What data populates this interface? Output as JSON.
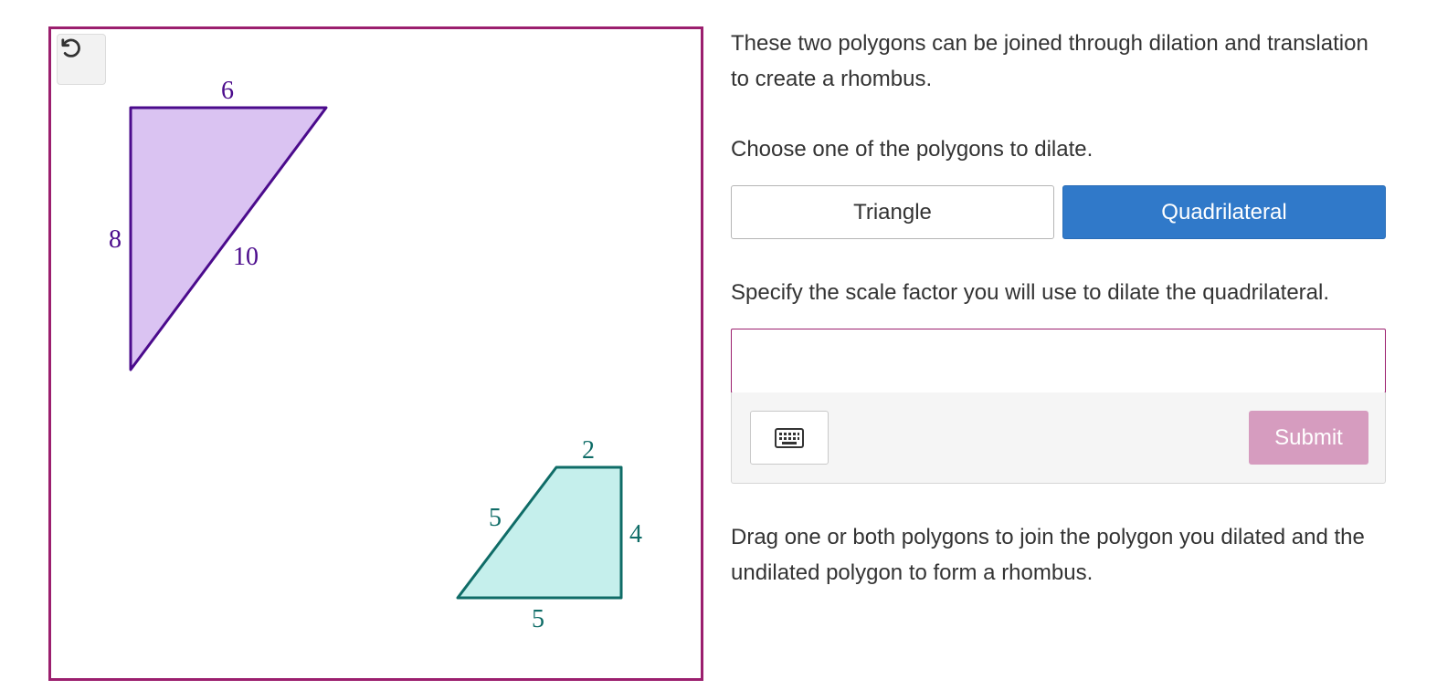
{
  "colors": {
    "canvas_border": "#9b1f6e",
    "triangle_fill": "#dac3f2",
    "triangle_stroke": "#4b0b8c",
    "quad_fill": "#c5efec",
    "quad_stroke": "#0f6c67",
    "selected_button": "#3079c9",
    "submit_disabled": "#d69cbf"
  },
  "canvas": {
    "reset_icon": "reset-icon",
    "triangle": {
      "labels": {
        "top": "6",
        "left": "8",
        "hypotenuse": "10"
      }
    },
    "quadrilateral": {
      "labels": {
        "top": "2",
        "right": "4",
        "bottom": "5",
        "slant": "5"
      }
    }
  },
  "panel": {
    "intro": "These two polygons can be joined through dilation and translation to create a rhombus.",
    "choose_prompt": "Choose one of the polygons to dilate.",
    "options": [
      {
        "label": "Triangle",
        "selected": false
      },
      {
        "label": "Quadrilateral",
        "selected": true
      }
    ],
    "scale_prompt": "Specify the scale factor you will use to dilate the quadrilateral.",
    "answer": {
      "value": "",
      "placeholder": ""
    },
    "keyboard_icon": "keyboard-icon",
    "submit_label": "Submit",
    "drag_prompt": "Drag one or both polygons to join the polygon you dilated and the undilated polygon to form a rhombus."
  }
}
